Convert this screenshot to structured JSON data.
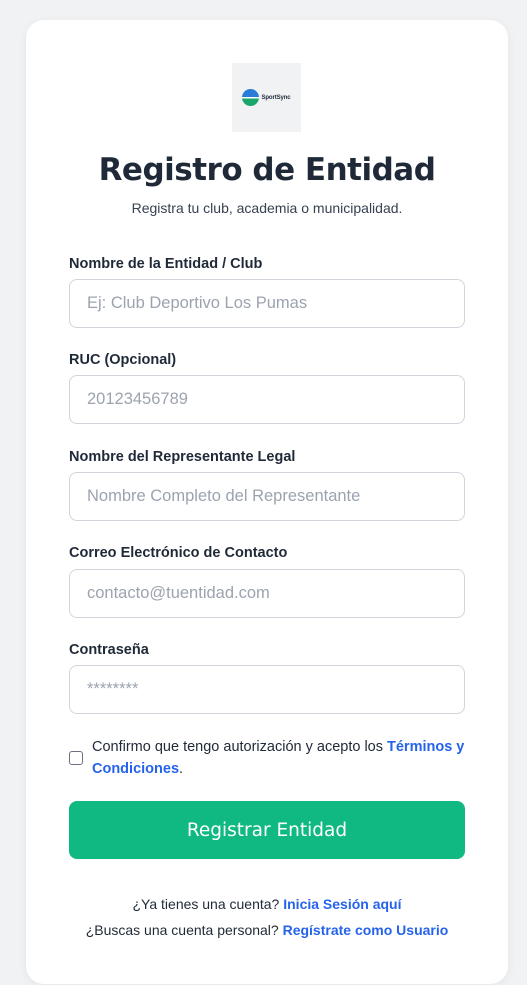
{
  "logo": {
    "text": "SportSync"
  },
  "header": {
    "title": "Registro de Entidad",
    "subtitle": "Registra tu club, academia o municipalidad."
  },
  "form": {
    "entity_name": {
      "label": "Nombre de la Entidad / Club",
      "placeholder": "Ej: Club Deportivo Los Pumas",
      "value": ""
    },
    "ruc": {
      "label": "RUC (Opcional)",
      "placeholder": "20123456789",
      "value": ""
    },
    "representative": {
      "label": "Nombre del Representante Legal",
      "placeholder": "Nombre Completo del Representante",
      "value": ""
    },
    "email": {
      "label": "Correo Electrónico de Contacto",
      "placeholder": "contacto@tuentidad.com",
      "value": ""
    },
    "password": {
      "label": "Contraseña",
      "placeholder": "********",
      "value": ""
    },
    "terms": {
      "text": "Confirmo que tengo autorización y acepto los ",
      "link": "Términos y Condiciones",
      "suffix": ".",
      "checked": false
    },
    "submit_label": "Registrar Entidad"
  },
  "footer": {
    "login_prompt": "¿Ya tienes una cuenta? ",
    "login_link": "Inicia Sesión aquí",
    "user_prompt": "¿Buscas una cuenta personal? ",
    "user_link": "Regístrate como Usuario"
  },
  "colors": {
    "primary_button": "#10b981",
    "link": "#2563eb",
    "background": "#f1f2f4"
  }
}
